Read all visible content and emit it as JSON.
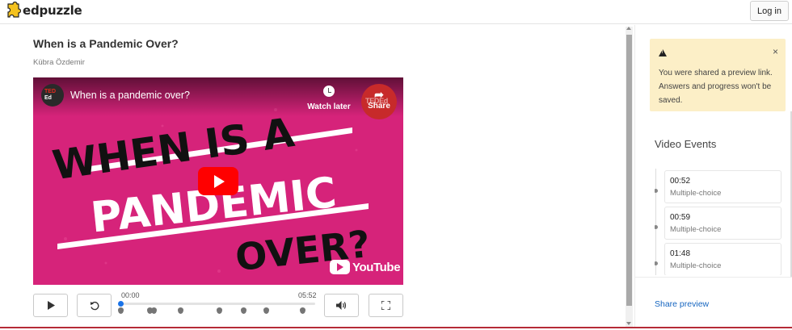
{
  "topbar": {
    "logo_text": "edpuzzle",
    "login_label": "Log in"
  },
  "video": {
    "title": "When is a Pandemic Over?",
    "author": "Kübra Özdemir"
  },
  "player": {
    "channel_badge_ted": "TED",
    "channel_badge_ed": "Ed",
    "yt_title": "When is a pandemic over?",
    "watch_later_label": "Watch later",
    "share_label": "Share",
    "share_ted_mark": "TEDEd",
    "thumbnail_text": [
      "WHEN IS A",
      "PANDEMIC",
      "OVER?"
    ],
    "yt_brand": "YouTube",
    "time_start": "00:00",
    "time_end": "05:52",
    "progress": 0.0,
    "icons": {
      "play": "play-icon",
      "rewind": "rewind-icon",
      "volume": "volume-icon",
      "fullscreen": "fullscreen-icon"
    }
  },
  "alert": {
    "message": "You were shared a preview link. Answers and progress won't be saved.",
    "close_symbol": "×"
  },
  "events": {
    "title": "Video Events",
    "items": [
      {
        "time": "00:52",
        "kind": "Multiple-choice"
      },
      {
        "time": "00:59",
        "kind": "Multiple-choice"
      },
      {
        "time": "01:48",
        "kind": "Multiple-choice"
      }
    ]
  },
  "share_preview_label": "Share preview",
  "colors": {
    "thumbnail_bg": "#d6237a",
    "alert_bg": "#fcefc7",
    "link": "#1565c0",
    "scrubber": "#1a73e8"
  }
}
